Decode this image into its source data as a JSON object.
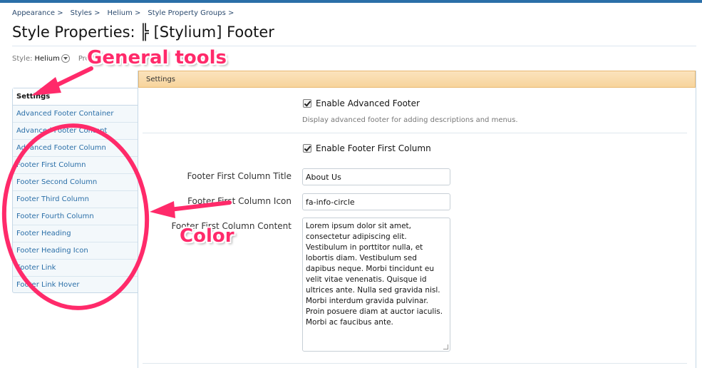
{
  "breadcrumb": [
    "Appearance >",
    "Styles >",
    "Helium >",
    "Style Property Groups >"
  ],
  "page_title": "Style Properties: ╠ [Stylium] Footer",
  "style_row": {
    "style_label": "Style:",
    "style_value": "Helium",
    "property_label": "Pro",
    "property_tail": "F"
  },
  "sidebar": {
    "header": "Settings",
    "items": [
      "Advanced Footer Container",
      "Advanced Footer Content",
      "Advanced Footer Column",
      "Footer First Column",
      "Footer Second Column",
      "Footer Third Column",
      "Footer Fourth Column",
      "Footer Heading",
      "Footer Heading Icon",
      "Footer Link",
      "Footer Link Hover"
    ]
  },
  "main": {
    "header": "Settings",
    "enable_advanced_footer": {
      "label": "Enable Advanced Footer",
      "hint": "Display advanced footer for adding descriptions and menus.",
      "checked": true
    },
    "enable_first_column": {
      "label": "Enable Footer First Column",
      "checked": true
    },
    "title_field": {
      "label": "Footer First Column Title",
      "value": "About Us"
    },
    "icon_field": {
      "label": "Footer First Column Icon",
      "value": "fa-info-circle"
    },
    "content_field": {
      "label": "Footer First Column Content",
      "value": "Lorem ipsum dolor sit amet, consectetur adipiscing elit. Vestibulum in porttitor nulla, et lobortis diam. Vestibulum sed dapibus neque. Morbi tincidunt eu velit vitae venenatis. Quisque id ultrices ante. Nulla sed gravida nisl. Morbi interdum gravida pulvinar. Proin posuere diam at auctor iaculis. Morbi ac faucibus ante."
    }
  },
  "annotations": {
    "general_tools": "General tools",
    "color": "Color",
    "color_hex": "#ff2a6a"
  }
}
